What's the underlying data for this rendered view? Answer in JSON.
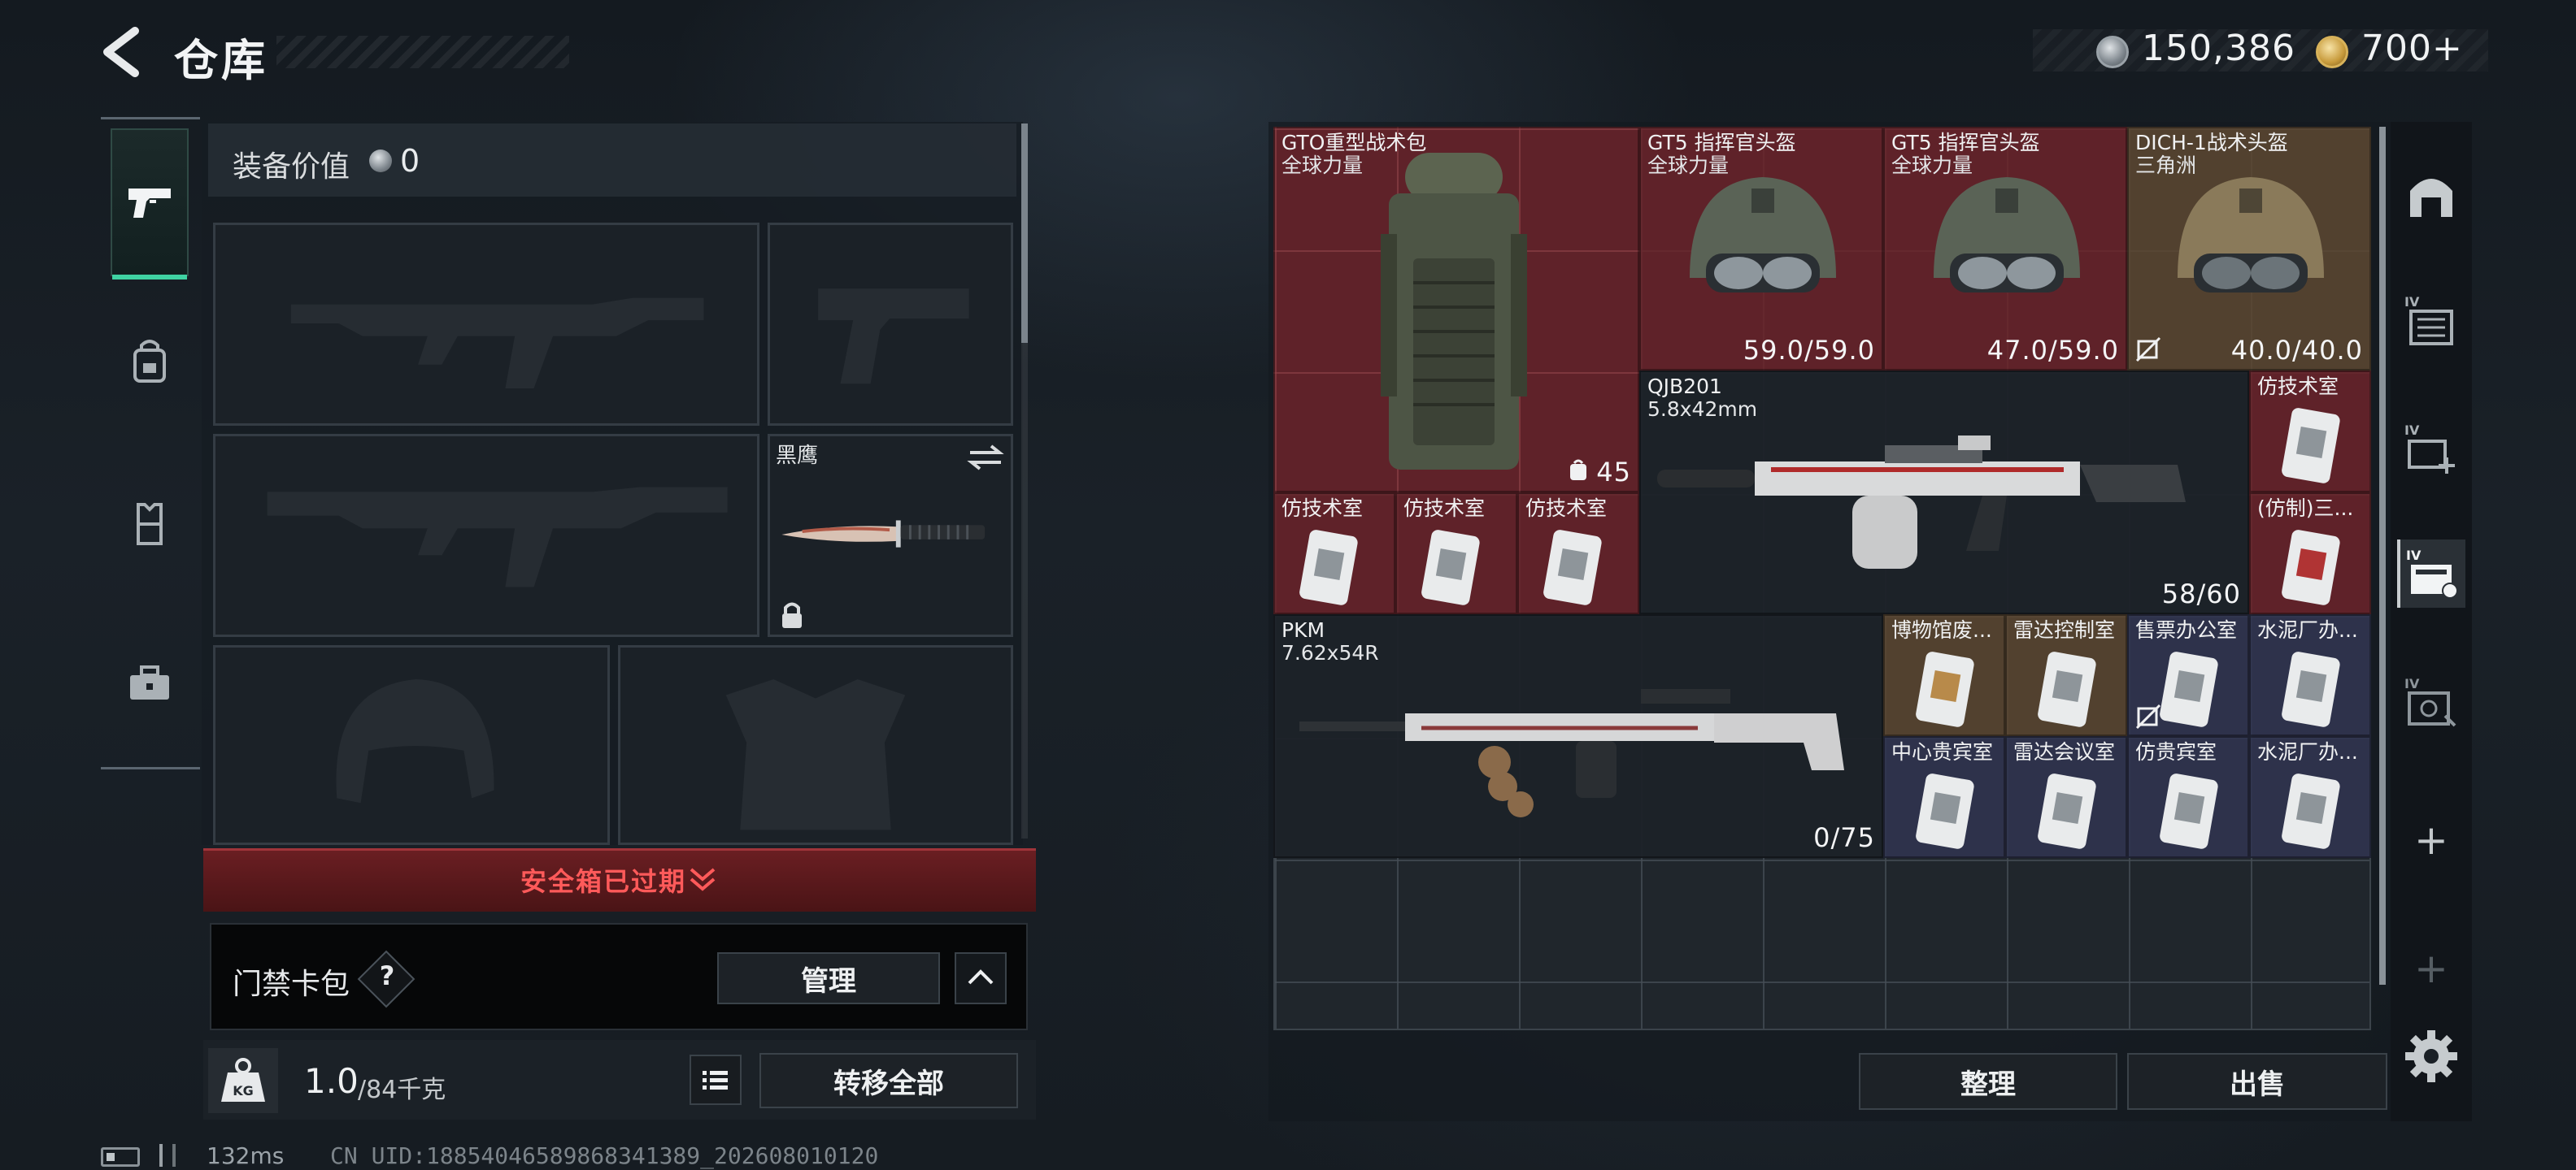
{
  "header": {
    "title": "仓库",
    "currency_silver": "150,386",
    "currency_gold": "700+"
  },
  "left_rail": {
    "tabs": [
      {
        "icon": "pistol-icon",
        "active": true
      },
      {
        "icon": "backpack-icon",
        "active": false
      },
      {
        "icon": "vest-icon",
        "active": false
      },
      {
        "icon": "briefcase-icon",
        "active": false
      }
    ]
  },
  "equipment": {
    "value_label": "装备价值",
    "value": "0",
    "knife_name": "黑鹰"
  },
  "safe_box": {
    "status": "安全箱已过期"
  },
  "keycard": {
    "label": "门禁卡包",
    "help": "?",
    "manage": "管理"
  },
  "weight": {
    "current": "1.0",
    "max": "/84千克",
    "transfer_all": "转移全部"
  },
  "status": {
    "ping": "132ms",
    "uid": "CN UID:18854046589868341389_202608010120"
  },
  "storage": {
    "items": [
      {
        "name": "GTO重型战术包",
        "sub": "全球力量",
        "value": "45",
        "color": "red"
      },
      {
        "name": "GT5 指挥官头盔",
        "sub": "全球力量",
        "value": "59.0/59.0",
        "color": "red"
      },
      {
        "name": "GT5 指挥官头盔",
        "sub": "全球力量",
        "value": "47.0/59.0",
        "color": "red"
      },
      {
        "name": "DICH-1战术头盔",
        "sub": "三角洲",
        "value": "40.0/40.0",
        "color": "gold"
      },
      {
        "name": "QJB201",
        "sub": "5.8x42mm",
        "value": "58/60",
        "color": "dark"
      },
      {
        "name": "仿技术室",
        "color": "red"
      },
      {
        "name": "(仿制)三...",
        "color": "red"
      },
      {
        "name": "仿技术室",
        "color": "red"
      },
      {
        "name": "仿技术室",
        "color": "red"
      },
      {
        "name": "仿技术室",
        "color": "red"
      },
      {
        "name": "PKM",
        "sub": "7.62x54R",
        "value": "0/75",
        "color": "dark"
      },
      {
        "name": "博物馆废...",
        "color": "gold"
      },
      {
        "name": "雷达控制室",
        "color": "gold"
      },
      {
        "name": "售票办公室",
        "color": "navy"
      },
      {
        "name": "水泥厂办...",
        "color": "navy"
      },
      {
        "name": "中心贵宾室",
        "color": "navy"
      },
      {
        "name": "雷达会议室",
        "color": "navy"
      },
      {
        "name": "仿贵宾室",
        "color": "navy"
      },
      {
        "name": "水泥厂办...",
        "color": "navy"
      }
    ]
  },
  "right_rail": {
    "plus": "+"
  },
  "actions": {
    "sort": "整理",
    "sell": "出售"
  },
  "colors": {
    "accent_green": "#3fd3a2",
    "expired_red": "#ff5a5a",
    "item_red": "#6e2228",
    "item_gold": "#5c4630",
    "item_navy": "#303450"
  }
}
